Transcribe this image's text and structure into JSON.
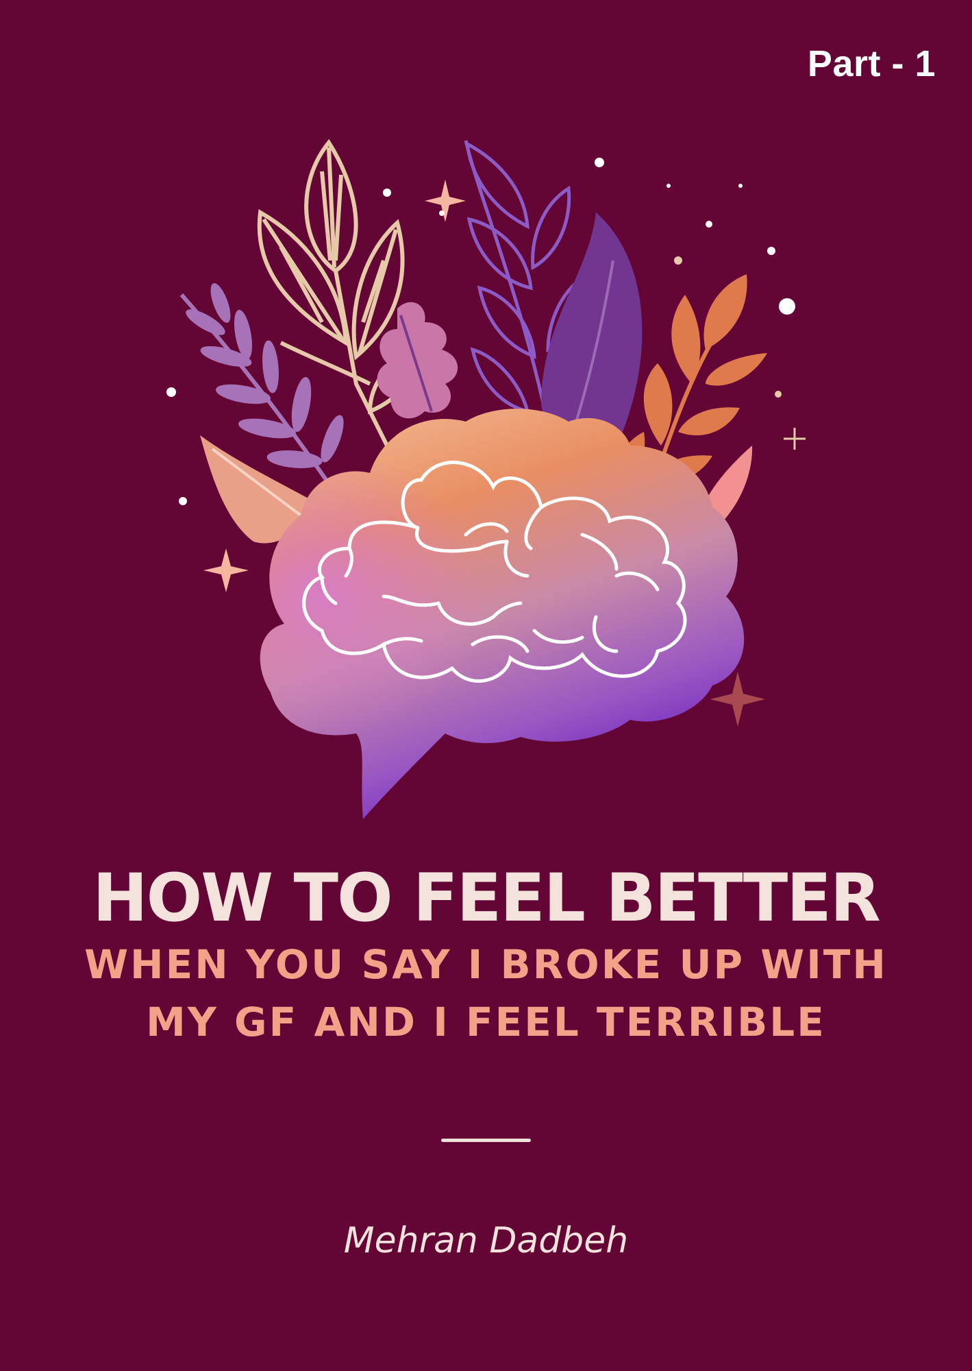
{
  "part_label": "Part - 1",
  "title": "HOW TO FEEL BETTER",
  "subtitle_lines": [
    "WHEN YOU SAY I BROKE UP WITH",
    "MY GF AND I FEEL TERRIBLE"
  ],
  "author": "Mehran Dadbeh",
  "colors": {
    "background": "#630535",
    "title": "#f4e3dc",
    "subtitle": "#f2a288"
  },
  "illustration": "brain-with-leaves-illustration"
}
